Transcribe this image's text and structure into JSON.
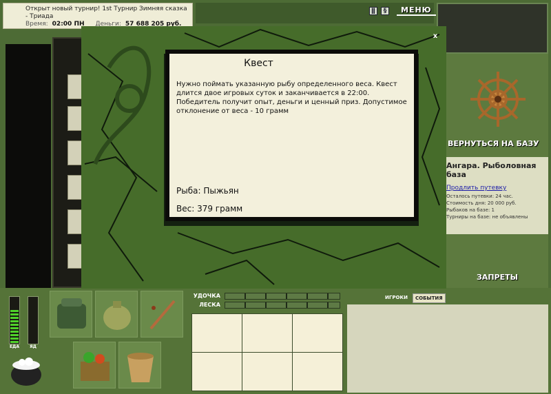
{
  "topbar": {
    "news": "Открыт новый турнир! 1st Турнир Зимняя сказка - Триада",
    "time_label": "Время:",
    "time_value": "02:00 ПН",
    "money_label": "Деньги:",
    "money_value": "57 688 205 руб."
  },
  "header": {
    "pause_icon": "pause-icon",
    "sound_icon": "sound-icon",
    "menu_label": "МЕНЮ"
  },
  "modal": {
    "close_label": "x",
    "title": "Квест",
    "text": "Нужно поймать указанную рыбу определенного веса. Квест длится двое игровых суток и заканчивается в 22:00. Победитель получит опыт, деньги и ценный приз. Допустимое отклонение от веса - 10 грамм",
    "fish": "Рыба: Пыжьян",
    "weight": "Вес: 379 грамм"
  },
  "right_panel": {
    "return_button": "ВЕРНУТЬСЯ НА БАЗУ",
    "base_name": "Ангара. Рыболовная база",
    "extend_link": "Продлить путевку",
    "lines": [
      "Осталось путевки: 24 час.",
      "Стоимость дня: 20 000 руб.",
      "Рыбаков на базе: 1",
      "Турниры на базе: не объявлены"
    ],
    "bans_button": "ЗАПРЕТЫ"
  },
  "bottom": {
    "food_label": "ЕДА",
    "bait_label": "ЯД",
    "food_level": 0.72,
    "bait_level": 0,
    "rod_label": "УДОЧКА",
    "line_label": "ЛЕСКА",
    "tab_players": "ИГРОКИ",
    "tab_events": "СОБЫТИЯ"
  },
  "colors": {
    "background": "#4d6b35",
    "dialog_bg": "#f3f0dc",
    "accent_green": "#4fd12a"
  }
}
